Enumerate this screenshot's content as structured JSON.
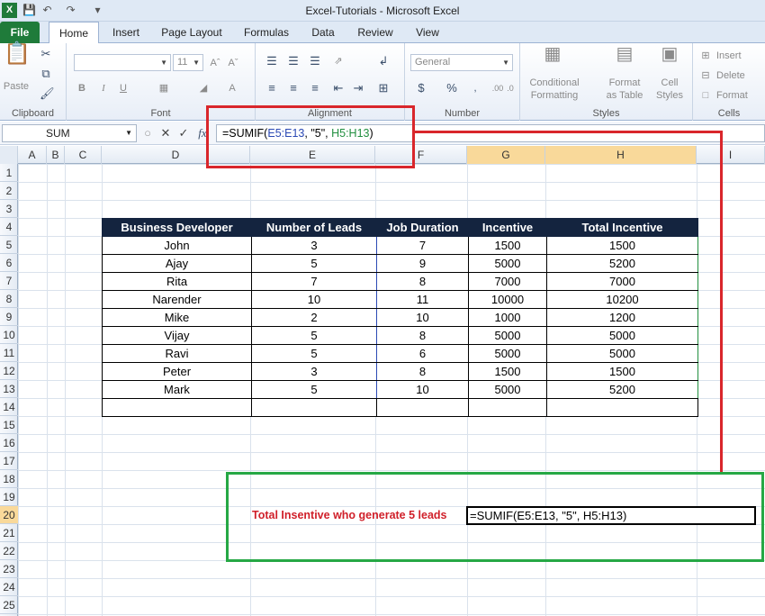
{
  "window": {
    "title": "Excel-Tutorials  -  Microsoft Excel"
  },
  "ribbon": {
    "tabs": [
      "File",
      "Home",
      "Insert",
      "Page Layout",
      "Formulas",
      "Data",
      "Review",
      "View"
    ],
    "groups": {
      "clipboard": {
        "label": "Clipboard",
        "paste": "Paste"
      },
      "font": {
        "label": "Font",
        "size": "11",
        "bold": "B",
        "italic": "I",
        "underline": "U"
      },
      "alignment": {
        "label": "Alignment"
      },
      "number": {
        "label": "Number",
        "format": "General"
      },
      "styles": {
        "label": "Styles",
        "conditional": "Conditional",
        "conditional2": "Formatting",
        "format_as": "Format",
        "format_as2": "as Table",
        "cell": "Cell",
        "cell2": "Styles"
      },
      "cells": {
        "label": "Cells",
        "insert": "Insert",
        "delete": "Delete",
        "format": "Format"
      }
    }
  },
  "formula_bar": {
    "name_box": "SUM",
    "fx": "fx",
    "formula_prefix": "=SUMIF(",
    "formula_range1": "E5:E13",
    "formula_mid": ", \"5\", ",
    "formula_range2": "H5:H13",
    "formula_suffix": ")"
  },
  "columns": [
    "A",
    "B",
    "C",
    "D",
    "E",
    "F",
    "G",
    "H",
    "I"
  ],
  "rows": [
    "1",
    "2",
    "3",
    "4",
    "5",
    "6",
    "7",
    "8",
    "9",
    "10",
    "11",
    "12",
    "13",
    "14",
    "15",
    "16",
    "17",
    "18",
    "19",
    "20",
    "21",
    "22",
    "23",
    "24",
    "25"
  ],
  "table": {
    "headers": [
      "Business Developer",
      "Number of Leads",
      "Job Duration",
      "Incentive",
      "Total Incentive"
    ],
    "rows": [
      [
        "John",
        "3",
        "7",
        "1500",
        "1500"
      ],
      [
        "Ajay",
        "5",
        "9",
        "5000",
        "5200"
      ],
      [
        "Rita",
        "7",
        "8",
        "7000",
        "7000"
      ],
      [
        "Narender",
        "10",
        "11",
        "10000",
        "10200"
      ],
      [
        "Mike",
        "2",
        "10",
        "1000",
        "1200"
      ],
      [
        "Vijay",
        "5",
        "8",
        "5000",
        "5000"
      ],
      [
        "Ravi",
        "5",
        "6",
        "5000",
        "5000"
      ],
      [
        "Peter",
        "3",
        "8",
        "1500",
        "1500"
      ],
      [
        "Mark",
        "5",
        "10",
        "5000",
        "5200"
      ]
    ]
  },
  "result": {
    "label": "Total Insentive who generate 5 leads",
    "formula": "=SUMIF(E5:E13, \"5\", H5:H13)"
  },
  "colors": {
    "header_bg": "#14243f",
    "accent_red": "#d9262b",
    "accent_green": "#26a845",
    "file_tab": "#1f7b3a"
  }
}
